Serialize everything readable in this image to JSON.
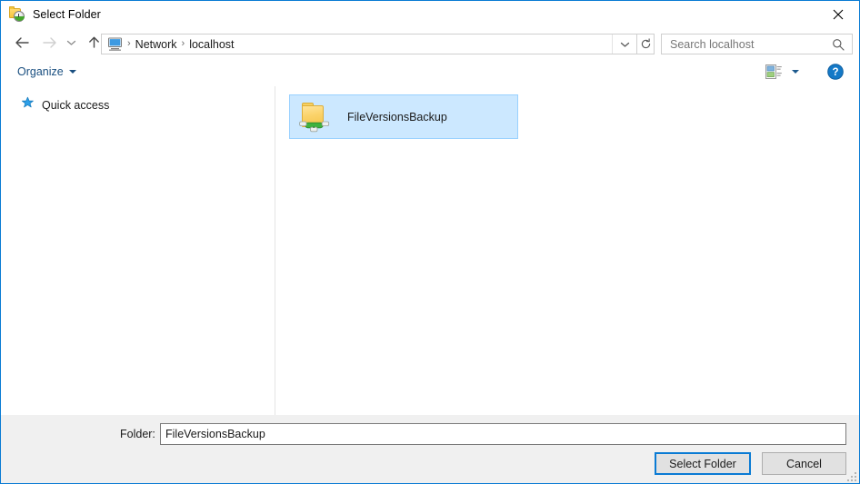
{
  "window": {
    "title": "Select Folder",
    "title_icon": "folder-clock-icon",
    "close_icon": "close-icon",
    "border_color": "#0a7bd4"
  },
  "nav": {
    "back_icon": "back-arrow-icon",
    "forward_icon": "forward-arrow-icon",
    "recent_icon": "recent-locations-chevron-icon",
    "up_icon": "up-arrow-icon",
    "breadcrumb_icon": "computer-icon",
    "breadcrumb": [
      {
        "label": "Network"
      },
      {
        "label": "localhost"
      }
    ],
    "separator": "›",
    "address_chevron_icon": "chevron-down-icon",
    "refresh_icon": "refresh-icon"
  },
  "search": {
    "placeholder": "Search localhost",
    "value": "",
    "icon": "search-icon"
  },
  "toolbar": {
    "organize_label": "Organize",
    "organize_caret_icon": "caret-down-icon",
    "view_icon": "view-layout-icon",
    "view_caret_icon": "caret-down-icon",
    "help_icon": "help-question-icon",
    "help_label": "?"
  },
  "sidebar": {
    "items": [
      {
        "label": "Quick access",
        "icon": "star-pin-icon"
      }
    ]
  },
  "content": {
    "items": [
      {
        "name": "FileVersionsBackup",
        "icon": "network-shared-folder-icon",
        "selected": true
      }
    ],
    "selection_color": "#cce8ff"
  },
  "footer": {
    "folder_label": "Folder:",
    "folder_value": "FileVersionsBackup",
    "select_button": "Select Folder",
    "cancel_button": "Cancel",
    "resize_grip_icon": "resize-grip-icon"
  }
}
